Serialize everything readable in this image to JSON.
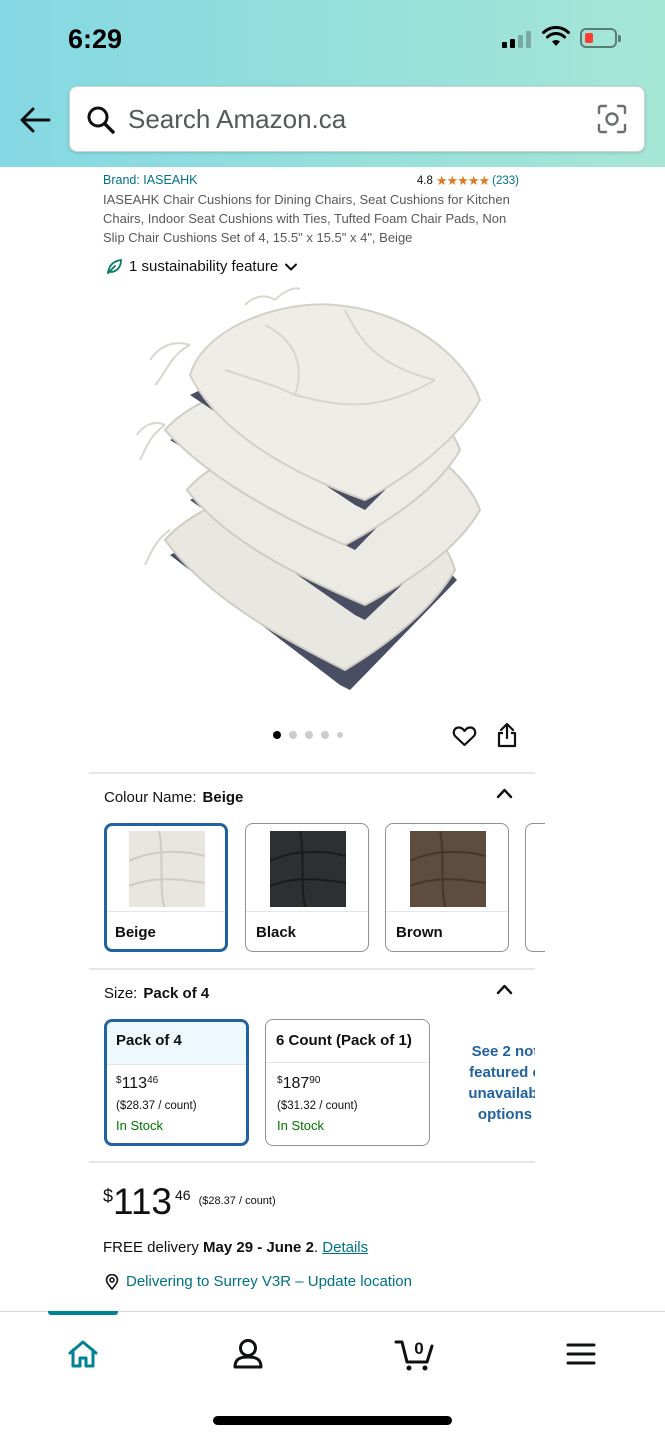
{
  "status_bar": {
    "time": "6:29"
  },
  "search": {
    "placeholder": "Search Amazon.ca"
  },
  "product": {
    "brand": "Brand: IASEAHK",
    "rating": "4.8",
    "stars": "★★★★★",
    "rating_count": "(233)",
    "title": "IASEAHK Chair Cushions for Dining Chairs, Seat Cushions for Kitchen Chairs, Indoor Seat Cushions with Ties, Tufted Foam Chair Pads, Non Slip Chair Cushions Set of 4, 15.5\" x 15.5\" x 4\", Beige",
    "sustainability": "1 sustainability feature"
  },
  "gallery": {
    "image_count": 5,
    "active_index": 0
  },
  "colour": {
    "label": "Colour Name:",
    "selected": "Beige",
    "options": [
      {
        "name": "Beige",
        "color": "#e8e6df"
      },
      {
        "name": "Black",
        "color": "#2e2f30"
      },
      {
        "name": "Brown",
        "color": "#5e4c3e"
      }
    ]
  },
  "size": {
    "label": "Size:",
    "selected": "Pack of 4",
    "options": [
      {
        "name": "Pack of 4",
        "currency": "$",
        "whole": "113",
        "fraction": "46",
        "unit_price": "($28.37 / count)",
        "stock": "In Stock"
      },
      {
        "name": "6 Count (Pack of 1)",
        "currency": "$",
        "whole": "187",
        "fraction": "90",
        "unit_price": "($31.32 / count)",
        "stock": "In Stock"
      }
    ],
    "see_more": [
      "See 2 not",
      "featured c",
      "unavailabl",
      "options"
    ]
  },
  "price": {
    "currency": "$",
    "whole": "113",
    "fraction": "46",
    "unit_price": "($28.37 / count)"
  },
  "delivery": {
    "prefix": "FREE delivery ",
    "dates": "May 29 - June 2",
    "suffix": ". ",
    "details_link": "Details",
    "location": "Delivering to Surrey V3R – Update location"
  },
  "tabbar": {
    "items": [
      "home-icon",
      "account-icon",
      "cart-icon",
      "menu-icon"
    ],
    "cart_count": "0",
    "active": "home"
  },
  "colors": {
    "link": "#007185",
    "selected_border": "#2162a1",
    "stock": "#007600",
    "star": "#de7921",
    "accent": "#008296"
  }
}
